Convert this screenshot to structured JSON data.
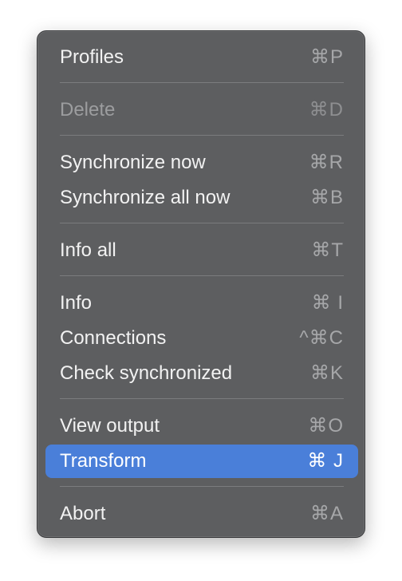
{
  "menu": {
    "items": [
      {
        "label": "Profiles",
        "shortcut": "⌘P"
      },
      {
        "label": "Delete",
        "shortcut": "⌘D"
      },
      {
        "label": "Synchronize now",
        "shortcut": "⌘R"
      },
      {
        "label": "Synchronize all now",
        "shortcut": "⌘B"
      },
      {
        "label": "Info all",
        "shortcut": "⌘T"
      },
      {
        "label": "Info",
        "shortcut": "⌘ I"
      },
      {
        "label": "Connections",
        "shortcut": "^⌘C"
      },
      {
        "label": "Check synchronized",
        "shortcut": "⌘K"
      },
      {
        "label": "View output",
        "shortcut": "⌘O"
      },
      {
        "label": "Transform",
        "shortcut": "⌘ J"
      },
      {
        "label": "Abort",
        "shortcut": "⌘A"
      }
    ],
    "disabled_item": "Delete",
    "highlighted_item": "Transform"
  },
  "colors": {
    "menu_background": "#5d5e60",
    "highlight": "#4a7fd9",
    "text": "#f2f2f2",
    "shortcut_text": "#a6a7a9"
  }
}
